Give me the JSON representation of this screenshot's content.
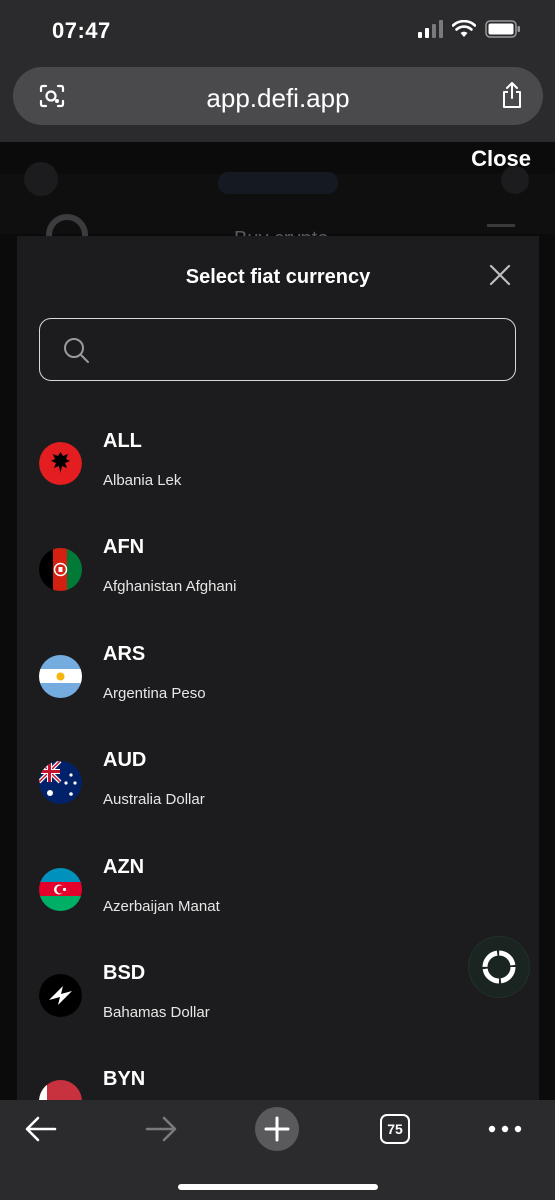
{
  "status_bar": {
    "time": "07:47"
  },
  "browser": {
    "url": "app.defi.app",
    "tab_count": "75"
  },
  "background_page": {
    "title": "Buy crypto",
    "close_label": "Close"
  },
  "modal": {
    "title": "Select fiat currency",
    "search": {
      "placeholder": "",
      "value": ""
    }
  },
  "currencies": [
    {
      "code": "ALL",
      "name": "Albania Lek"
    },
    {
      "code": "AFN",
      "name": "Afghanistan Afghani"
    },
    {
      "code": "ARS",
      "name": "Argentina Peso"
    },
    {
      "code": "AUD",
      "name": "Australia Dollar"
    },
    {
      "code": "AZN",
      "name": "Azerbaijan Manat"
    },
    {
      "code": "BSD",
      "name": "Bahamas Dollar"
    },
    {
      "code": "BYN",
      "name": ""
    }
  ],
  "colors": {
    "sheet": "#1c1c1e",
    "browser_chrome": "#2b2b2d",
    "url_pill": "#4a4a4d"
  }
}
